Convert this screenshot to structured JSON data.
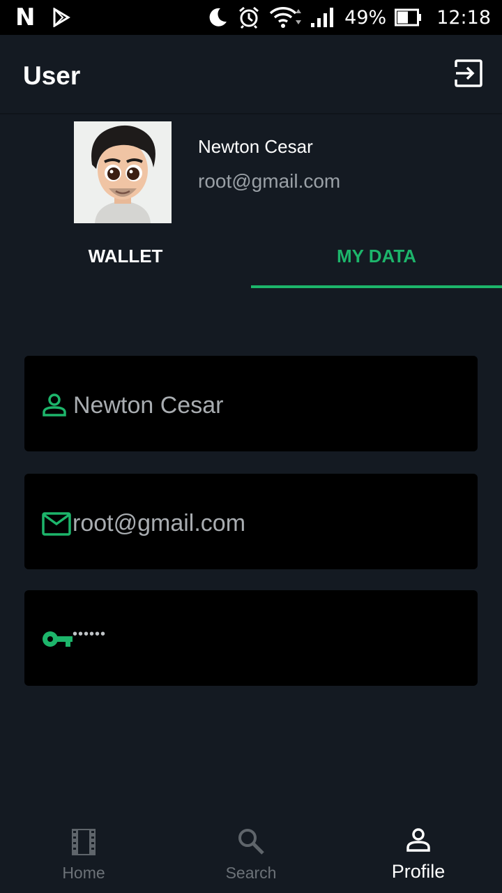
{
  "status_bar": {
    "battery": "49%",
    "time": "12:18"
  },
  "app_bar": {
    "title": "User"
  },
  "profile": {
    "name": "Newton Cesar",
    "email": "root@gmail.com"
  },
  "tabs": [
    {
      "label": "WALLET",
      "selected": false
    },
    {
      "label": "MY DATA",
      "selected": true
    }
  ],
  "fields": {
    "name": "Newton Cesar",
    "email": "root@gmail.com",
    "password": "••••••"
  },
  "bottom_nav": {
    "items": [
      {
        "label": "Home",
        "icon": "film-icon",
        "active": false
      },
      {
        "label": "Search",
        "icon": "search-icon",
        "active": false
      },
      {
        "label": "Profile",
        "icon": "person-icon",
        "active": true
      }
    ]
  },
  "colors": {
    "accent": "#1db56b",
    "background": "#141a22",
    "field_background": "#000000"
  }
}
